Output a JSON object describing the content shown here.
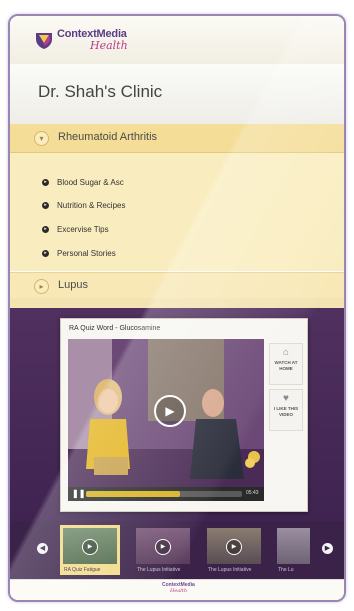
{
  "brand": {
    "name": "ContextMedia",
    "sub": "Health"
  },
  "clinic": {
    "title": "Dr. Shah's Clinic"
  },
  "menu": {
    "open_section": "Rheumatoid Arthritis",
    "items": [
      "Blood Sugar & Asc",
      "Nutrition & Recipes",
      "Excervise Tips",
      "Personal Stories"
    ],
    "closed_section": "Lupus"
  },
  "player": {
    "title": "RA Quiz Word - Glucosamine",
    "time": "05:43",
    "progress": 0.6,
    "side_buttons": [
      {
        "icon": "home-icon",
        "label": "WATCH AT HOME"
      },
      {
        "icon": "heart-icon",
        "label": "I LIKE THIS VIDEO"
      }
    ]
  },
  "carousel": {
    "thumbnails": [
      {
        "caption": "RA Quiz Fatigue",
        "selected": true
      },
      {
        "caption": "The Lupus Initiative",
        "selected": false
      },
      {
        "caption": "The Lupus Initiative",
        "selected": false
      },
      {
        "caption": "The Lu",
        "selected": false
      }
    ]
  },
  "footer": {
    "name": "ContextMedia",
    "sub": "Health"
  },
  "colors": {
    "accent": "#f4dd97",
    "purple": "#3f2350",
    "brand": "#5b3c86",
    "progress": "#d8b326"
  }
}
